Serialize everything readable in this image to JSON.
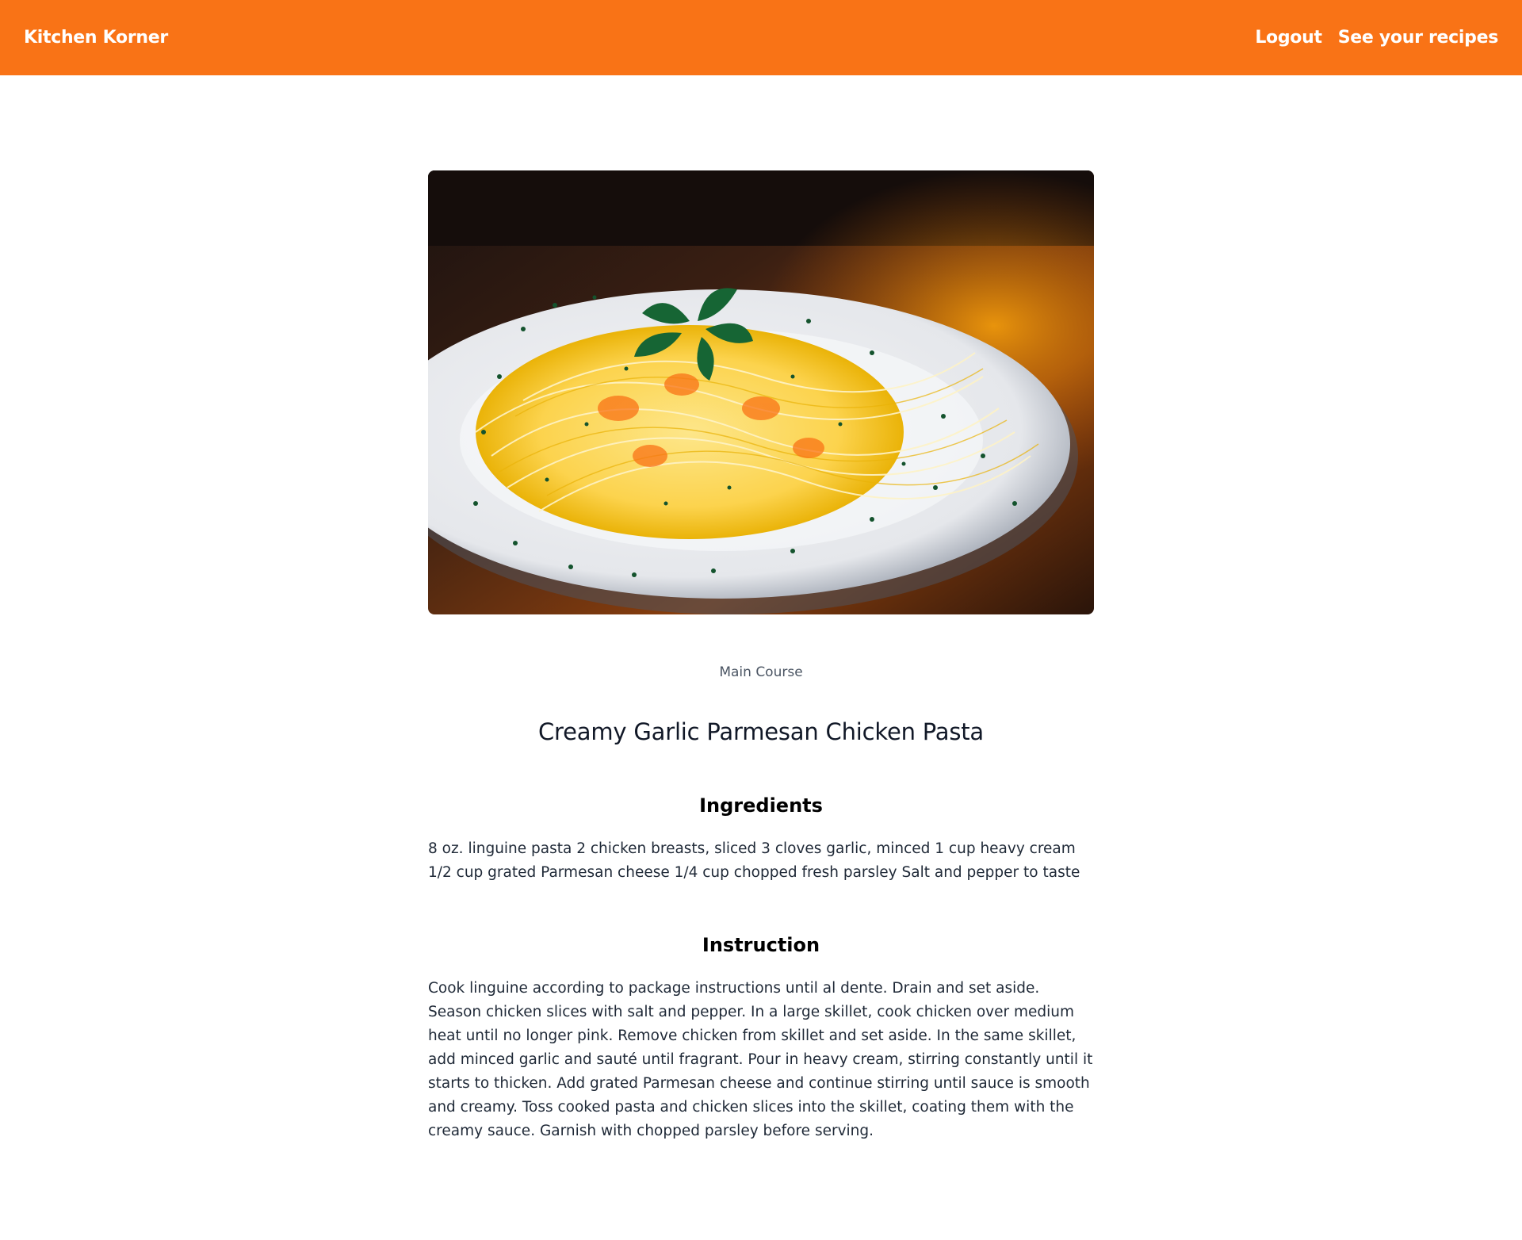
{
  "navbar": {
    "brand": "Kitchen Korner",
    "links": [
      {
        "label": "Logout"
      },
      {
        "label": "See your recipes"
      }
    ],
    "background": "#f97316"
  },
  "recipe": {
    "image_icon": "pasta-plate-photo",
    "category": "Main Course",
    "title": "Creamy Garlic Parmesan Chicken Pasta",
    "ingredients_heading": "Ingredients",
    "ingredients": "8 oz. linguine pasta 2 chicken breasts, sliced 3 cloves garlic, minced 1 cup heavy cream 1/2 cup grated Parmesan cheese 1/4 cup chopped fresh parsley Salt and pepper to taste",
    "instruction_heading": "Instruction",
    "instruction": "Cook linguine according to package instructions until al dente. Drain and set aside. Season chicken slices with salt and pepper. In a large skillet, cook chicken over medium heat until no longer pink. Remove chicken from skillet and set aside. In the same skillet, add minced garlic and sauté until fragrant. Pour in heavy cream, stirring constantly until it starts to thicken. Add grated Parmesan cheese and continue stirring until sauce is smooth and creamy. Toss cooked pasta and chicken slices into the skillet, coating them with the creamy sauce. Garnish with chopped parsley before serving."
  }
}
